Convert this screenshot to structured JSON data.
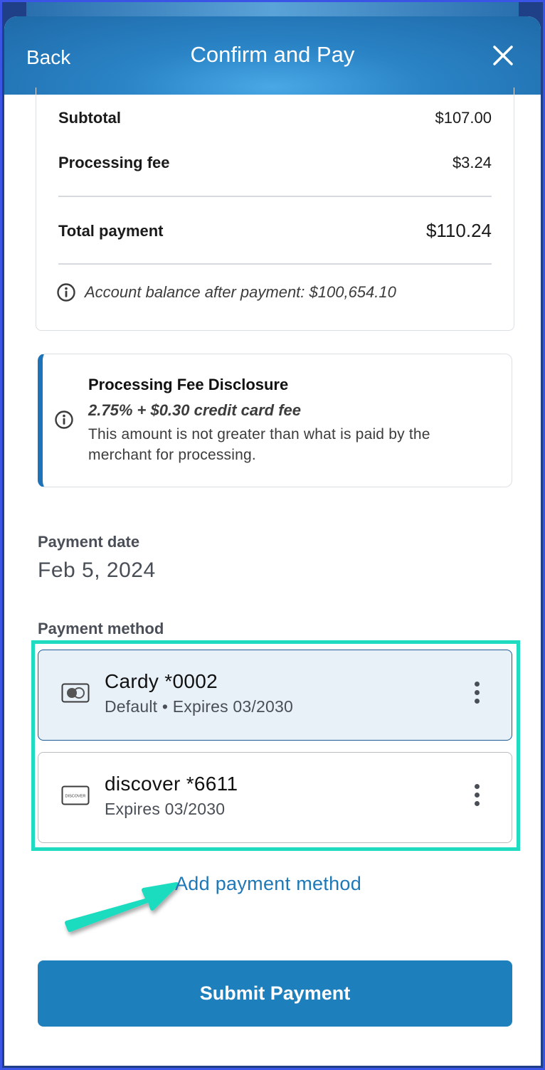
{
  "header": {
    "back_label": "Back",
    "title": "Confirm and Pay",
    "close_icon": "close-icon"
  },
  "summary": {
    "subtotal_label": "Subtotal",
    "subtotal_value": "$107.00",
    "fee_label": "Processing fee",
    "fee_value": "$3.24",
    "total_label": "Total payment",
    "total_value": "$110.24",
    "balance_text": "Account balance after payment: $100,654.10",
    "balance_icon": "info-icon"
  },
  "disclosure": {
    "title": "Processing Fee Disclosure",
    "fee_text": "2.75% + $0.30 credit card fee",
    "body": "This amount is not greater than what is paid by the merchant for processing.",
    "icon": "info-icon",
    "accent_color": "#1e73b8"
  },
  "payment_date": {
    "label": "Payment date",
    "value": "Feb 5, 2024"
  },
  "payment_method": {
    "label": "Payment method",
    "cards": [
      {
        "name": "Cardy *0002",
        "subtitle": "Default • Expires 03/2030",
        "icon": "generic-card-icon",
        "selected": true
      },
      {
        "name": "discover *6611",
        "subtitle": "Expires 03/2030",
        "icon": "discover-card-icon",
        "selected": false,
        "brand_text": "DISCOVER"
      }
    ],
    "add_label": "Add payment method"
  },
  "submit": {
    "label": "Submit Payment",
    "color": "#1e7fbd"
  },
  "annotation": {
    "highlight_color": "#1fdcc0",
    "arrow_color": "#1fdcc0"
  }
}
